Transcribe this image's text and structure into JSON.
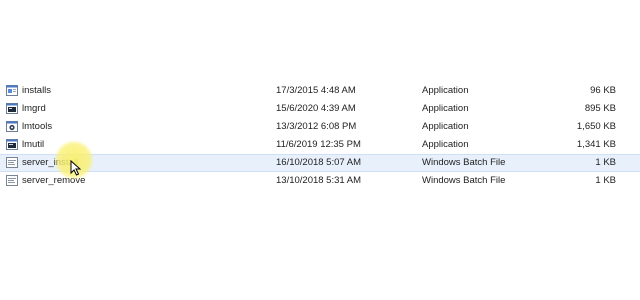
{
  "files": [
    {
      "name": "installs",
      "date": "17/3/2015 4:48 AM",
      "type": "Application",
      "size": "96 KB",
      "icon": "application-icon",
      "selected": false
    },
    {
      "name": "lmgrd",
      "date": "15/6/2020 4:39 AM",
      "type": "Application",
      "size": "895 KB",
      "icon": "application-icon",
      "selected": false
    },
    {
      "name": "lmtools",
      "date": "13/3/2012 6:08 PM",
      "type": "Application",
      "size": "1,650 KB",
      "icon": "application-icon",
      "selected": false
    },
    {
      "name": "lmutil",
      "date": "11/6/2019 12:35 PM",
      "type": "Application",
      "size": "1,341 KB",
      "icon": "application-icon",
      "selected": false
    },
    {
      "name": "server_install",
      "date": "16/10/2018 5:07 AM",
      "type": "Windows Batch File",
      "size": "1 KB",
      "icon": "batch-file-icon",
      "selected": true
    },
    {
      "name": "server_remove",
      "date": "13/10/2018 5:31 AM",
      "type": "Windows Batch File",
      "size": "1 KB",
      "icon": "batch-file-icon",
      "selected": false
    }
  ],
  "colors": {
    "selection_bg": "#e8f0fb",
    "cursor_highlight": "#faf06e"
  }
}
